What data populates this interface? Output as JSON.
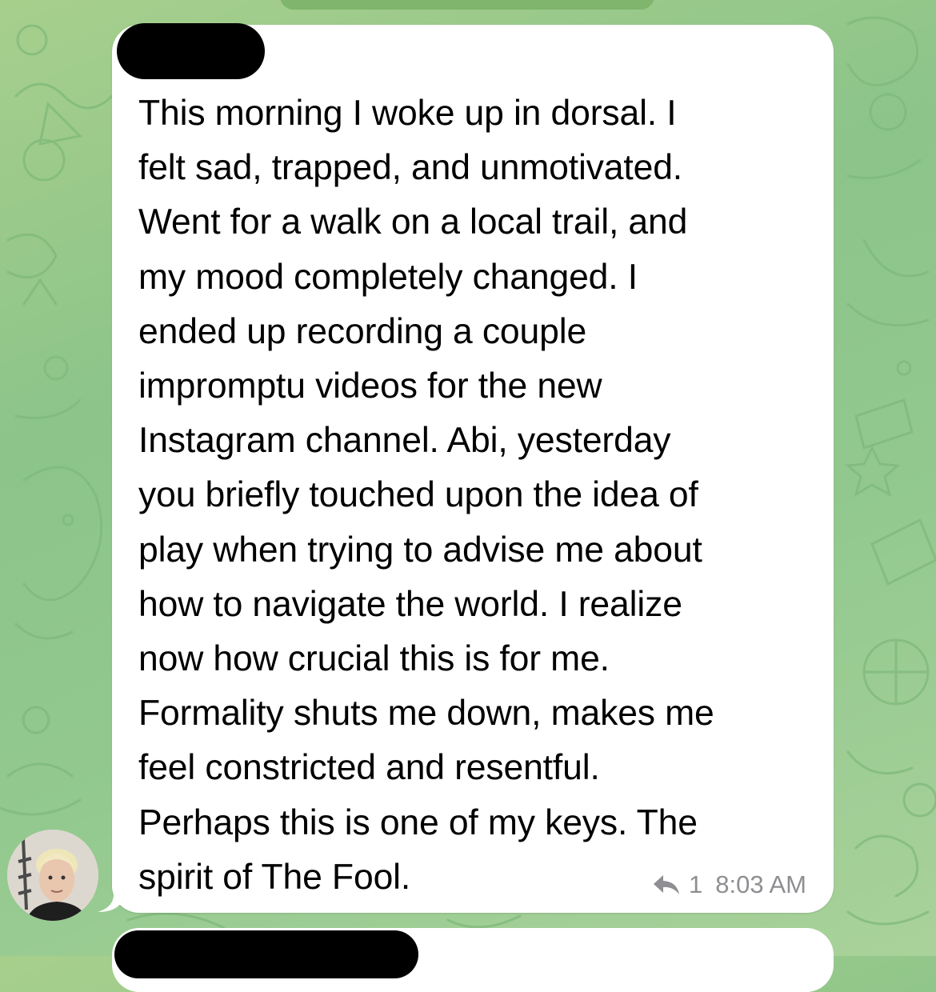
{
  "message": {
    "text": "This morning I woke up in dorsal. I\nfelt sad, trapped, and unmotivated.\nWent for a walk on a local trail, and\nmy mood completely changed. I\nended up recording a couple\nimpromptu videos for the new\nInstagram channel. Abi, yesterday\nyou briefly touched upon the idea of\nplay when trying to advise me about\nhow to navigate the world. I realize\nnow how crucial this is for me.\nFormality shuts me down, makes me\nfeel constricted and resentful.\nPerhaps this is one of my keys. The\nspirit of The Fool.",
    "reply_count": "1",
    "time": "8:03 AM",
    "reply_icon": "reply-arrow-icon"
  },
  "colors": {
    "background": "#93c98f",
    "bubble": "#ffffff",
    "meta_text": "#8e8e93",
    "redaction": "#000000"
  }
}
